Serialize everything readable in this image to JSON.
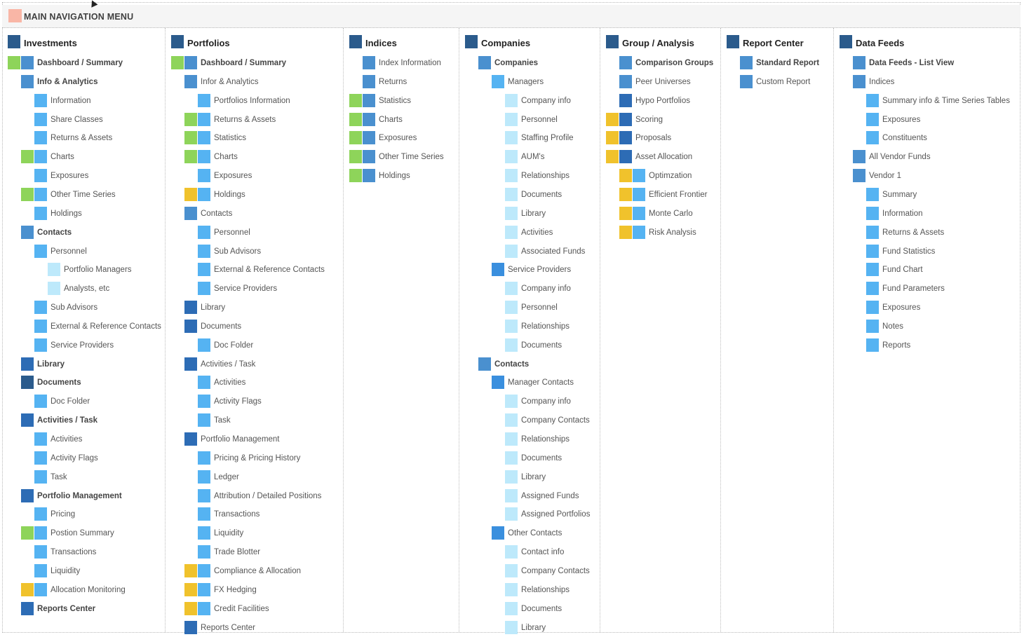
{
  "header": {
    "title": "MAIN NAVIGATION MENU",
    "icon_color": "#f9b6a6"
  },
  "columns": [
    {
      "title": "Investments",
      "items": [
        {
          "label": "Dashboard / Summary",
          "d": 1,
          "c": 1,
          "b": true,
          "tag": "g"
        },
        {
          "label": "Info & Analytics",
          "d": 1,
          "c": 1,
          "b": true
        },
        {
          "label": "Information",
          "d": 2,
          "c": 2
        },
        {
          "label": "Share Classes",
          "d": 2,
          "c": 2
        },
        {
          "label": "Returns & Assets",
          "d": 2,
          "c": 2
        },
        {
          "label": "Charts",
          "d": 2,
          "c": 2,
          "tag": "g"
        },
        {
          "label": "Exposures",
          "d": 2,
          "c": 2
        },
        {
          "label": "Other Time Series",
          "d": 2,
          "c": 2,
          "tag": "g"
        },
        {
          "label": "Holdings",
          "d": 2,
          "c": 2
        },
        {
          "label": "Contacts",
          "d": 1,
          "c": 1,
          "b": true
        },
        {
          "label": "Personnel",
          "d": 2,
          "c": 2
        },
        {
          "label": "Portfolio Managers",
          "d": 3,
          "c": 3
        },
        {
          "label": "Analysts, etc",
          "d": 3,
          "c": 3
        },
        {
          "label": "Sub Advisors",
          "d": 2,
          "c": 2
        },
        {
          "label": "External & Reference Contacts",
          "d": 2,
          "c": 2
        },
        {
          "label": "Service Providers",
          "d": 2,
          "c": 2
        },
        {
          "label": "Library",
          "d": 1,
          "c": 4,
          "b": true
        },
        {
          "label": "Documents",
          "d": 1,
          "c": 0,
          "b": true
        },
        {
          "label": "Doc Folder",
          "d": 2,
          "c": 2
        },
        {
          "label": "Activities / Task",
          "d": 1,
          "c": 4,
          "b": true
        },
        {
          "label": "Activities",
          "d": 2,
          "c": 2
        },
        {
          "label": "Activity Flags",
          "d": 2,
          "c": 2
        },
        {
          "label": "Task",
          "d": 2,
          "c": 2
        },
        {
          "label": "Portfolio Management",
          "d": 1,
          "c": 4,
          "b": true
        },
        {
          "label": "Pricing",
          "d": 2,
          "c": 2
        },
        {
          "label": "Postion Summary",
          "d": 2,
          "c": 2,
          "tag": "g"
        },
        {
          "label": "Transactions",
          "d": 2,
          "c": 2
        },
        {
          "label": "Liquidity",
          "d": 2,
          "c": 2
        },
        {
          "label": "Allocation Monitoring",
          "d": 2,
          "c": 2,
          "tag": "y"
        },
        {
          "label": "Reports Center",
          "d": 1,
          "c": 4,
          "b": true
        }
      ]
    },
    {
      "title": "Portfolios",
      "items": [
        {
          "label": "Dashboard / Summary",
          "d": 1,
          "c": 1,
          "b": true,
          "tag": "g"
        },
        {
          "label": "Infor & Analytics",
          "d": 1,
          "c": 1
        },
        {
          "label": "Portfolios Information",
          "d": 2,
          "c": 2
        },
        {
          "label": "Returns & Assets",
          "d": 2,
          "c": 2,
          "tag": "g"
        },
        {
          "label": "Statistics",
          "d": 2,
          "c": 2,
          "tag": "g"
        },
        {
          "label": "Charts",
          "d": 2,
          "c": 2,
          "tag": "g"
        },
        {
          "label": "Exposures",
          "d": 2,
          "c": 2
        },
        {
          "label": "Holdings",
          "d": 2,
          "c": 2,
          "tag": "y"
        },
        {
          "label": "Contacts",
          "d": 1,
          "c": 1
        },
        {
          "label": "Personnel",
          "d": 2,
          "c": 2
        },
        {
          "label": "Sub Advisors",
          "d": 2,
          "c": 2
        },
        {
          "label": "External & Reference Contacts",
          "d": 2,
          "c": 2
        },
        {
          "label": "Service Providers",
          "d": 2,
          "c": 2
        },
        {
          "label": "Library",
          "d": 1,
          "c": 4
        },
        {
          "label": "Documents",
          "d": 1,
          "c": 4
        },
        {
          "label": "Doc Folder",
          "d": 2,
          "c": 2
        },
        {
          "label": "Activities / Task",
          "d": 1,
          "c": 4
        },
        {
          "label": "Activities",
          "d": 2,
          "c": 2
        },
        {
          "label": "Activity Flags",
          "d": 2,
          "c": 2
        },
        {
          "label": "Task",
          "d": 2,
          "c": 2
        },
        {
          "label": "Portfolio Management",
          "d": 1,
          "c": 4
        },
        {
          "label": "Pricing & Pricing History",
          "d": 2,
          "c": 2
        },
        {
          "label": "Ledger",
          "d": 2,
          "c": 2
        },
        {
          "label": "Attribution / Detailed Positions",
          "d": 2,
          "c": 2
        },
        {
          "label": "Transactions",
          "d": 2,
          "c": 2
        },
        {
          "label": "Liquidity",
          "d": 2,
          "c": 2
        },
        {
          "label": "Trade Blotter",
          "d": 2,
          "c": 2
        },
        {
          "label": "Compliance & Allocation",
          "d": 2,
          "c": 2,
          "tag": "y"
        },
        {
          "label": "FX Hedging",
          "d": 2,
          "c": 2,
          "tag": "y"
        },
        {
          "label": "Credit Facilities",
          "d": 2,
          "c": 2,
          "tag": "y"
        },
        {
          "label": "Reports Center",
          "d": 1,
          "c": 4
        }
      ]
    },
    {
      "title": "Indices",
      "items": [
        {
          "label": "Index Information",
          "d": 1,
          "c": 1
        },
        {
          "label": "Returns",
          "d": 1,
          "c": 1
        },
        {
          "label": "Statistics",
          "d": 1,
          "c": 1,
          "tag": "g"
        },
        {
          "label": "Charts",
          "d": 1,
          "c": 1,
          "tag": "g"
        },
        {
          "label": "Exposures",
          "d": 1,
          "c": 1,
          "tag": "g"
        },
        {
          "label": "Other Time Series",
          "d": 1,
          "c": 1,
          "tag": "g"
        },
        {
          "label": "Holdings",
          "d": 1,
          "c": 1,
          "tag": "g"
        }
      ]
    },
    {
      "title": "Companies",
      "items": [
        {
          "label": "Companies",
          "d": 1,
          "c": 1,
          "b": true
        },
        {
          "label": "Managers",
          "d": 2,
          "c": 2
        },
        {
          "label": "Company info",
          "d": 3,
          "c": 3
        },
        {
          "label": "Personnel",
          "d": 3,
          "c": 3
        },
        {
          "label": "Staffing Profile",
          "d": 3,
          "c": 3
        },
        {
          "label": "AUM's",
          "d": 3,
          "c": 3
        },
        {
          "label": "Relationships",
          "d": 3,
          "c": 3
        },
        {
          "label": "Documents",
          "d": 3,
          "c": 3
        },
        {
          "label": "Library",
          "d": 3,
          "c": 3
        },
        {
          "label": "Activities",
          "d": 3,
          "c": 3
        },
        {
          "label": "Associated Funds",
          "d": 3,
          "c": 3
        },
        {
          "label": "Service Providers",
          "d": 2,
          "c": 5
        },
        {
          "label": "Company info",
          "d": 3,
          "c": 3
        },
        {
          "label": "Personnel",
          "d": 3,
          "c": 3
        },
        {
          "label": "Relationships",
          "d": 3,
          "c": 3
        },
        {
          "label": "Documents",
          "d": 3,
          "c": 3
        },
        {
          "label": "Contacts",
          "d": 1,
          "c": 1,
          "b": true
        },
        {
          "label": "Manager Contacts",
          "d": 2,
          "c": 5
        },
        {
          "label": "Company info",
          "d": 3,
          "c": 3
        },
        {
          "label": "Company Contacts",
          "d": 3,
          "c": 3
        },
        {
          "label": "Relationships",
          "d": 3,
          "c": 3
        },
        {
          "label": "Documents",
          "d": 3,
          "c": 3
        },
        {
          "label": "Library",
          "d": 3,
          "c": 3
        },
        {
          "label": "Assigned Funds",
          "d": 3,
          "c": 3
        },
        {
          "label": "Assigned Portfolios",
          "d": 3,
          "c": 3
        },
        {
          "label": "Other Contacts",
          "d": 2,
          "c": 5
        },
        {
          "label": "Contact info",
          "d": 3,
          "c": 3
        },
        {
          "label": "Company Contacts",
          "d": 3,
          "c": 3
        },
        {
          "label": "Relationships",
          "d": 3,
          "c": 3
        },
        {
          "label": "Documents",
          "d": 3,
          "c": 3
        },
        {
          "label": "Library",
          "d": 3,
          "c": 3
        }
      ]
    },
    {
      "title": "Group / Analysis",
      "items": [
        {
          "label": "Comparison Groups",
          "d": 1,
          "c": 1,
          "b": true
        },
        {
          "label": "Peer Universes",
          "d": 1,
          "c": 1
        },
        {
          "label": "Hypo Portfolios",
          "d": 1,
          "c": 4
        },
        {
          "label": "Scoring",
          "d": 1,
          "c": 4,
          "tag": "y"
        },
        {
          "label": "Proposals",
          "d": 1,
          "c": 4,
          "tag": "y"
        },
        {
          "label": "Asset Allocation",
          "d": 1,
          "c": 4,
          "tag": "y"
        },
        {
          "label": "Optimzation",
          "d": 2,
          "c": 2,
          "tag": "y"
        },
        {
          "label": "Efficient Frontier",
          "d": 2,
          "c": 2,
          "tag": "y"
        },
        {
          "label": "Monte Carlo",
          "d": 2,
          "c": 2,
          "tag": "y"
        },
        {
          "label": "Risk Analysis",
          "d": 2,
          "c": 2,
          "tag": "y"
        }
      ]
    },
    {
      "title": "Report Center",
      "items": [
        {
          "label": "Standard Report",
          "d": 1,
          "c": 1,
          "b": true
        },
        {
          "label": "Custom Report",
          "d": 1,
          "c": 1
        }
      ]
    },
    {
      "title": "Data Feeds",
      "items": [
        {
          "label": "Data Feeds - List View",
          "d": 1,
          "c": 1,
          "b": true
        },
        {
          "label": "Indices",
          "d": 1,
          "c": 1
        },
        {
          "label": "Summary info & Time Series Tables",
          "d": 2,
          "c": 2
        },
        {
          "label": "Exposures",
          "d": 2,
          "c": 2
        },
        {
          "label": "Constituents",
          "d": 2,
          "c": 2
        },
        {
          "label": "All Vendor Funds",
          "d": 1,
          "c": 1
        },
        {
          "label": "Vendor 1",
          "d": 1,
          "c": 1
        },
        {
          "label": "Summary",
          "d": 2,
          "c": 2
        },
        {
          "label": "Information",
          "d": 2,
          "c": 2
        },
        {
          "label": "Returns & Assets",
          "d": 2,
          "c": 2
        },
        {
          "label": "Fund Statistics",
          "d": 2,
          "c": 2
        },
        {
          "label": "Fund Chart",
          "d": 2,
          "c": 2
        },
        {
          "label": "Fund Parameters",
          "d": 2,
          "c": 2
        },
        {
          "label": "Exposures",
          "d": 2,
          "c": 2
        },
        {
          "label": "Notes",
          "d": 2,
          "c": 2
        },
        {
          "label": "Reports",
          "d": 2,
          "c": 2
        }
      ]
    }
  ]
}
